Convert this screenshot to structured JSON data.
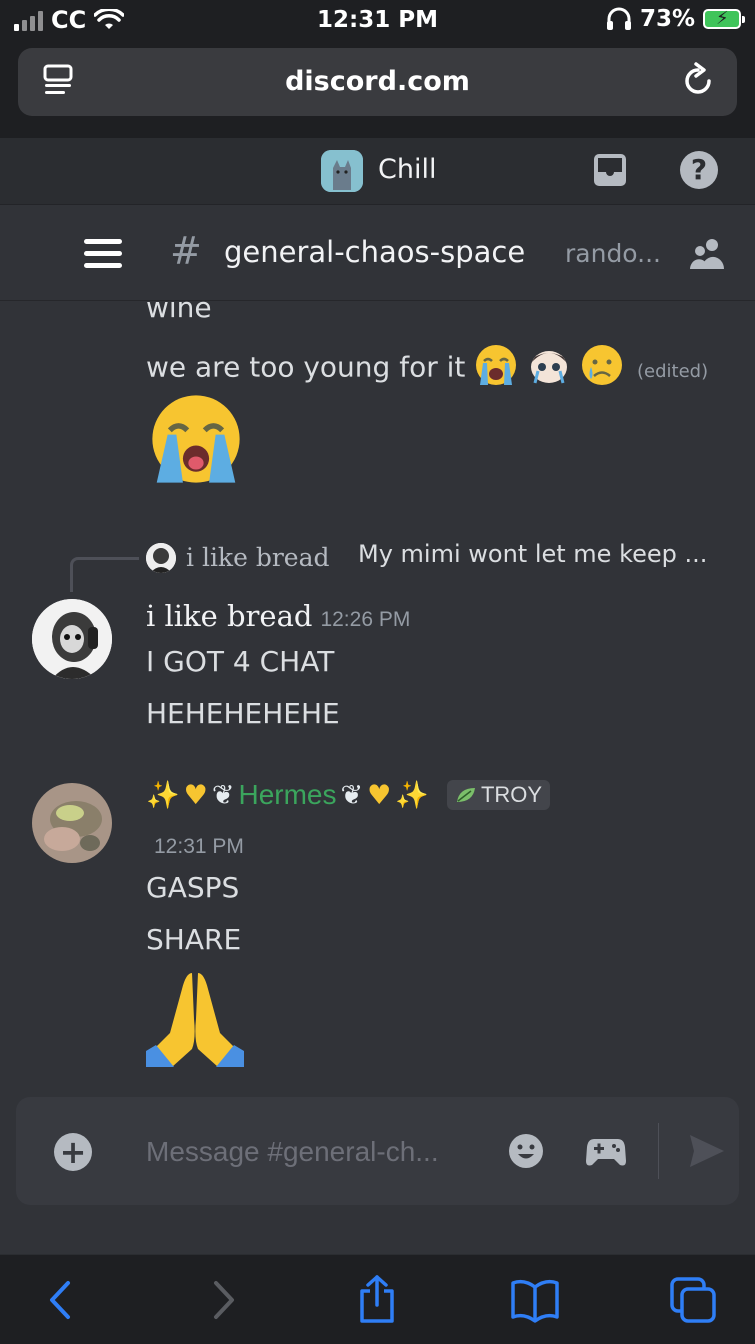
{
  "status_bar": {
    "carrier": "CC",
    "time": "12:31 PM",
    "battery": "73%"
  },
  "browser": {
    "url": "discord.com"
  },
  "server": {
    "name": "Chill"
  },
  "channel": {
    "name": "general-chaos-space",
    "next_channel": "rando..."
  },
  "messages": {
    "partial_top": "wine",
    "second": {
      "text": "we are too young for it",
      "edited": "(edited)"
    },
    "reply": {
      "author": "i like bread",
      "text": "My mimi wont let me keep ... r bottles of liquor"
    },
    "bread": {
      "author": "i like bread",
      "timestamp": "12:26 PM",
      "lines": [
        "I GOT 4 CHAT",
        "HEHEHEHEHE"
      ]
    },
    "hermes": {
      "name": "Hermes",
      "tag": "TROY",
      "timestamp": "12:31 PM",
      "lines": [
        "GASPS",
        "SHARE"
      ]
    }
  },
  "composer": {
    "placeholder": "Message #general-ch..."
  },
  "colors": {
    "background": "#313338",
    "hermes_name": "#3ba55d",
    "ios_blue": "#2f7ef6"
  }
}
